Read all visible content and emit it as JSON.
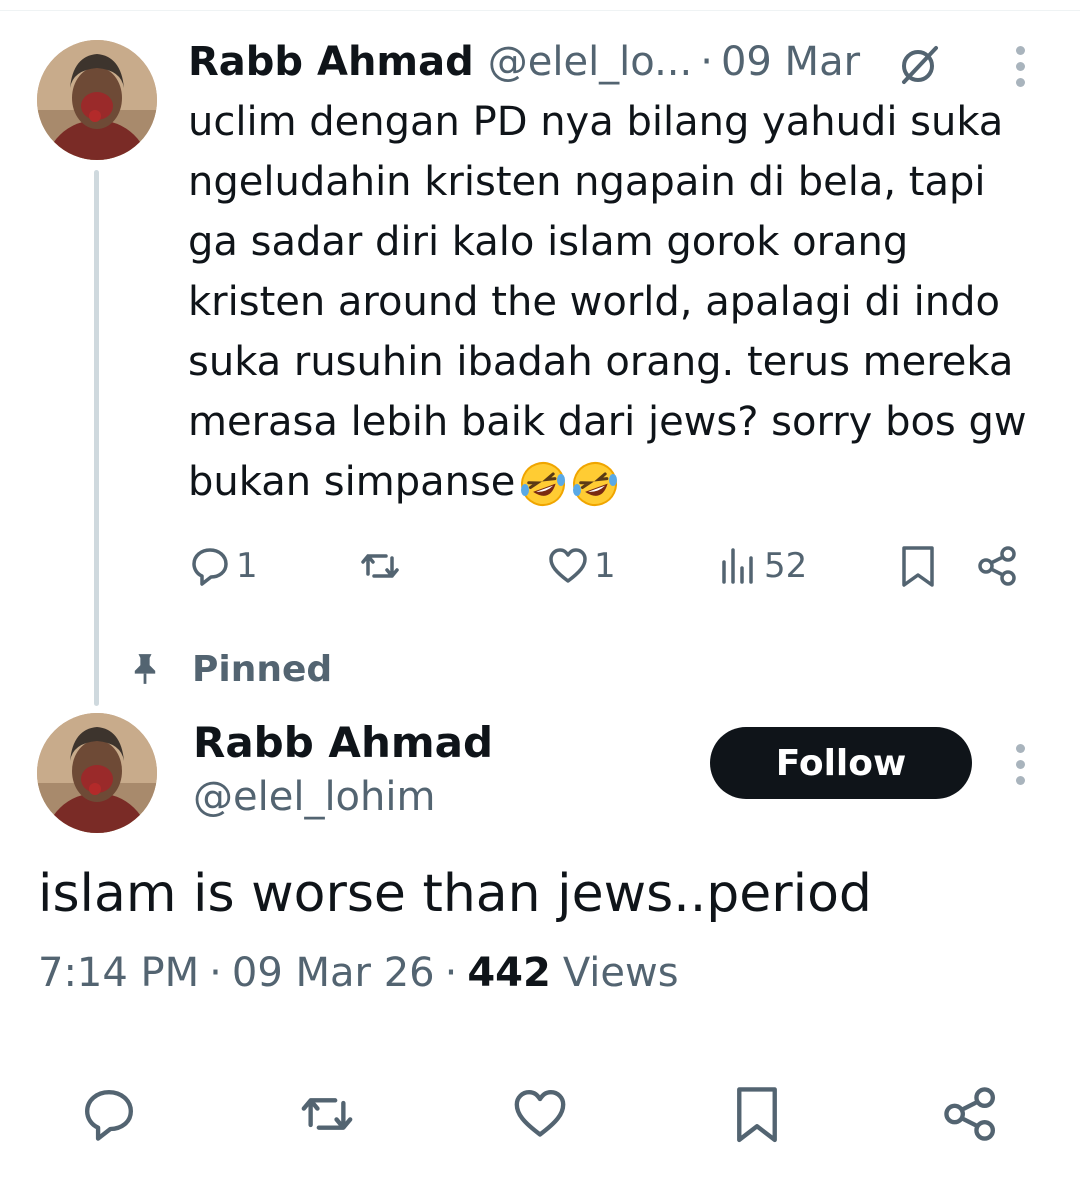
{
  "reply_tweet": {
    "author_name": "Rabb Ahmad",
    "author_handle": "@elel_lo...",
    "separator": "·",
    "time": "09 Mar",
    "text": "uclim dengan PD nya bilang yahudi suka\nngeludahin kristen ngapain di bela, tapi\nga sadar diri kalo islam gorok orang\nkristen around the world, apalagi di indo\nsuka rusuhin ibadah orang. terus mereka\nmerasa lebih baik dari jews? sorry bos gw\nbukan simpanse",
    "emojis": [
      "rolling-on-floor-laughing",
      "rolling-on-floor-laughing"
    ],
    "actions": {
      "replies": "1",
      "retweets": "",
      "likes": "1",
      "views": "52"
    }
  },
  "pinned_label": "Pinned",
  "main_tweet": {
    "author_name": "Rabb Ahmad",
    "author_handle": "@elel_lohim",
    "follow_label": "Follow",
    "text": "islam is worse than jews..period",
    "time": "7:14 PM",
    "separator": "·",
    "date": "09 Mar 26",
    "views_count": "442",
    "views_label": "Views"
  },
  "colors": {
    "text_primary": "#0f1419",
    "text_secondary": "#536471",
    "thread_line": "#cfd9de",
    "button_bg": "#0f1419",
    "button_text": "#ffffff"
  }
}
